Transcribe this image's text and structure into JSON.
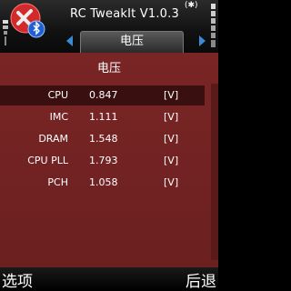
{
  "app": {
    "title": "RC TweakIt  V1.0.3",
    "status_indicator": "(✱)",
    "icon": "app-logo-icon"
  },
  "tabs": {
    "active": "电压"
  },
  "page": {
    "title": "电压",
    "rows": [
      {
        "label": "CPU",
        "value": "0.847",
        "unit": "[V]"
      },
      {
        "label": "IMC",
        "value": "1.111",
        "unit": "[V]"
      },
      {
        "label": "DRAM",
        "value": "1.548",
        "unit": "[V]"
      },
      {
        "label": "CPU PLL",
        "value": "1.793",
        "unit": "[V]"
      },
      {
        "label": "PCH",
        "value": "1.058",
        "unit": "[V]"
      }
    ]
  },
  "softkeys": {
    "left": "选项",
    "right": "后退"
  },
  "colors": {
    "content_bg": "#7a2525",
    "selected_row_bg": "#3a0f0f",
    "tab_arrow": "#3a8bd6"
  }
}
